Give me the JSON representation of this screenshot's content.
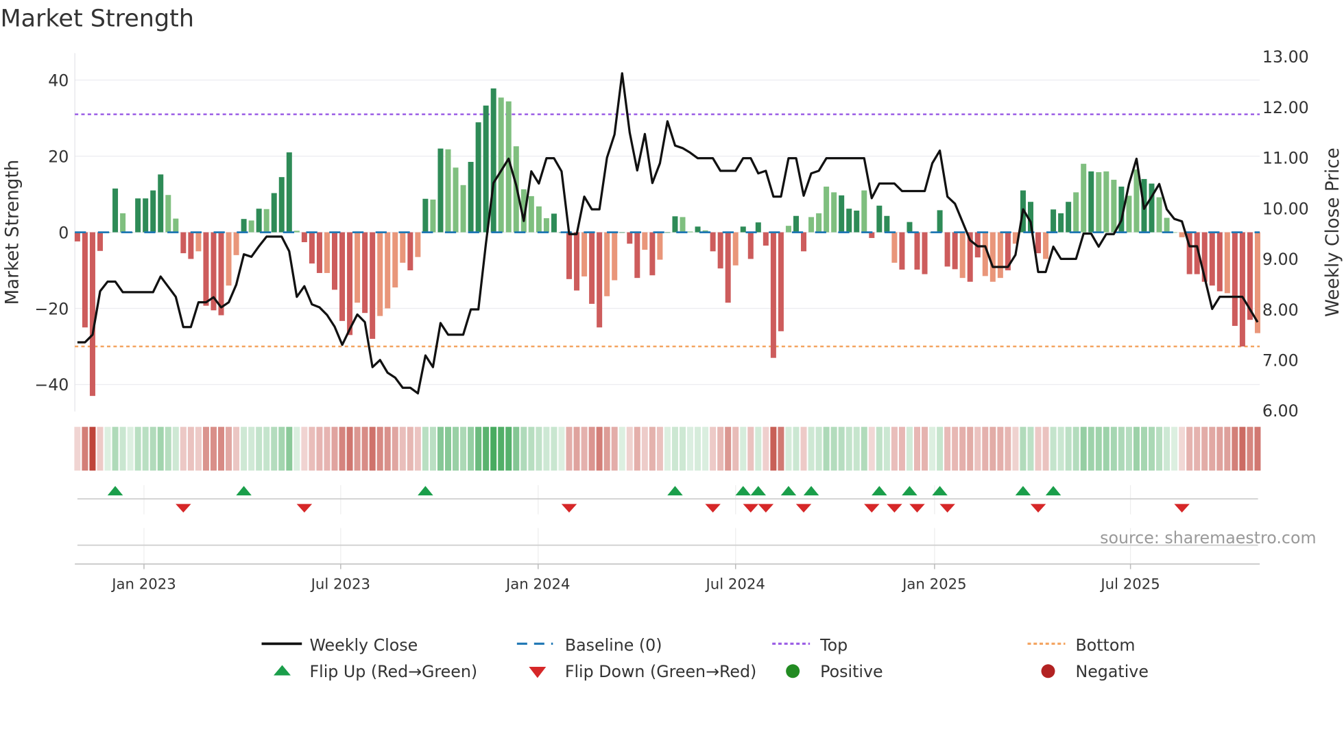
{
  "chart_data": {
    "type": "bar",
    "title": "Market Strength",
    "ylabel": "Market Strength",
    "ylabel_right": "Weekly Close Price",
    "ylim": [
      -46,
      46
    ],
    "ylim_right": [
      6.0,
      13.0
    ],
    "yticks": [
      {
        "v": 40,
        "label": "40"
      },
      {
        "v": 20,
        "label": "20"
      },
      {
        "v": 0,
        "label": "0"
      },
      {
        "v": -20,
        "label": "−20"
      },
      {
        "v": -40,
        "label": "−40"
      }
    ],
    "yticks_right": [
      {
        "v": 13,
        "label": "13.00"
      },
      {
        "v": 12,
        "label": "12.00"
      },
      {
        "v": 11,
        "label": "11.00"
      },
      {
        "v": 10,
        "label": "10.00"
      },
      {
        "v": 9,
        "label": "9.00"
      },
      {
        "v": 8,
        "label": "8.00"
      },
      {
        "v": 7,
        "label": "7.00"
      },
      {
        "v": 6,
        "label": "6.00"
      }
    ],
    "x_ticks": [
      {
        "week": 8.8,
        "label": "Jan 2023"
      },
      {
        "week": 34.8,
        "label": "Jul 2023"
      },
      {
        "week": 60.9,
        "label": "Jan 2024"
      },
      {
        "week": 87.0,
        "label": "Jul 2024"
      },
      {
        "week": 113.3,
        "label": "Jan 2025"
      },
      {
        "week": 139.2,
        "label": "Jul 2025"
      }
    ],
    "top_level": 31,
    "bottom_level": -30,
    "strength": [
      -2.4,
      -25,
      -43,
      -4.9,
      0,
      11.5,
      5,
      0,
      8.9,
      8.9,
      11,
      15.2,
      9.8,
      3.6,
      -5.5,
      -7,
      -5,
      -19.3,
      -20.5,
      -21.8,
      -14,
      -6,
      3.5,
      3.1,
      6.2,
      6.1,
      10.3,
      14.5,
      21,
      0.4,
      -2.6,
      -8.2,
      -10.7,
      -10.7,
      -15.1,
      -23.3,
      -27,
      -18.5,
      -21.2,
      -28,
      -22,
      -20,
      -14.5,
      -8,
      -10,
      -6.5,
      8.8,
      8.6,
      22,
      21.8,
      17,
      12.4,
      18.5,
      28.9,
      33.3,
      37.8,
      35.4,
      34.4,
      22.6,
      11.3,
      9.5,
      6.8,
      3.7,
      4.9,
      0,
      -12.3,
      -15.3,
      -11.6,
      -18.8,
      -25,
      -16.8,
      -12.6,
      0,
      -3,
      -12,
      -4.6,
      -11.3,
      -7.2,
      0,
      4.2,
      4,
      0.2,
      1.5,
      0.5,
      -5,
      -9.5,
      -18.5,
      -8.7,
      1.5,
      -7,
      2.6,
      -3.5,
      -33,
      -26,
      1.7,
      4.3,
      -5,
      4,
      5,
      12,
      10.5,
      9.7,
      6.2,
      5.7,
      11,
      -1.5,
      7,
      4.3,
      -8,
      -9.8,
      2.7,
      -9.8,
      -11,
      0,
      5.8,
      -9,
      -9.7,
      -12,
      -13,
      -6.6,
      -11.5,
      -13,
      -12,
      -10,
      -3,
      11,
      8,
      -5.5,
      -7,
      6,
      5,
      8,
      10.5,
      18,
      16,
      15.8,
      16,
      13.8,
      12,
      9.6,
      16.5,
      14,
      12.8,
      9.2,
      3.8,
      0,
      -1.3,
      -11,
      -11,
      -13,
      -14,
      -15.5,
      -16,
      -24.6,
      -30,
      -23,
      -26.5
    ],
    "shade": "DDDDLDLDDDDDLLDDLDDDLLDLDLDDDLDDDLDDDLDDLLLLDLDLDLLLDDDDLLLLLLLDDDDLDDLLDDDLDLDDLLDLDDDLDDDDDDLDDLLLLDDDLDDDLDDDDDDDDLDDLLLDLDDDLDDDLLDLLLDLLDDLLLLDDDDDLDDDLD",
    "close": [
      7.35,
      7.35,
      7.5,
      8.36,
      8.55,
      8.55,
      8.34,
      8.34,
      8.34,
      8.34,
      8.34,
      8.65,
      8.45,
      8.25,
      7.65,
      7.65,
      8.14,
      8.14,
      8.24,
      8.04,
      8.14,
      8.49,
      9.09,
      9.04,
      9.25,
      9.44,
      9.44,
      9.44,
      9.15,
      8.25,
      8.46,
      8.1,
      8.04,
      7.89,
      7.66,
      7.3,
      7.61,
      7.9,
      7.75,
      6.86,
      7.0,
      6.75,
      6.65,
      6.45,
      6.45,
      6.34,
      7.09,
      6.86,
      7.73,
      7.5,
      7.5,
      7.5,
      8.0,
      8.0,
      9.3,
      10.5,
      10.74,
      10.98,
      10.46,
      9.75,
      10.73,
      10.49,
      10.99,
      10.99,
      10.73,
      9.49,
      9.49,
      10.23,
      9.98,
      9.98,
      11.0,
      11.46,
      12.67,
      11.5,
      10.75,
      11.47,
      10.5,
      10.89,
      11.72,
      11.24,
      11.19,
      11.1,
      10.99,
      10.99,
      10.99,
      10.74,
      10.74,
      10.74,
      10.99,
      10.99,
      10.69,
      10.74,
      10.23,
      10.23,
      10.99,
      10.99,
      10.25,
      10.69,
      10.74,
      10.99,
      10.99,
      10.99,
      10.99,
      10.99,
      10.99,
      10.2,
      10.49,
      10.49,
      10.49,
      10.34,
      10.34,
      10.34,
      10.34,
      10.89,
      11.14,
      10.23,
      10.09,
      9.73,
      9.37,
      9.25,
      9.25,
      8.84,
      8.84,
      8.84,
      9.08,
      9.98,
      9.73,
      8.74,
      8.74,
      9.24,
      9.0,
      9.0,
      9.0,
      9.5,
      9.5,
      9.24,
      9.49,
      9.49,
      9.76,
      10.48,
      10.98,
      9.99,
      10.23,
      10.48,
      9.98,
      9.79,
      9.74,
      9.25,
      9.25,
      8.63,
      8.01,
      8.25,
      8.25,
      8.25,
      8.25,
      8.0,
      7.75
    ],
    "colors": {
      "pos_strong": "#2e8b57",
      "pos_weak": "#7fbf7f",
      "neg_strong": "#cd5c5c",
      "neg_weak": "#e9967a",
      "close": "#111111",
      "baseline": "#1f77b4",
      "top": "#9b5de5",
      "bottom": "#f4a460",
      "flip_up": "#1a9e4a",
      "flip_down": "#d62728",
      "positive": "#228b22",
      "negative": "#b22222"
    },
    "legend": {
      "weekly_close": "Weekly Close",
      "baseline": "Baseline (0)",
      "top": "Top",
      "bottom": "Bottom",
      "flip_up": "Flip Up (Red→Green)",
      "flip_down": "Flip Down (Green→Red)",
      "positive": "Positive",
      "negative": "Negative"
    },
    "source": "source: sharemaestro.com"
  }
}
